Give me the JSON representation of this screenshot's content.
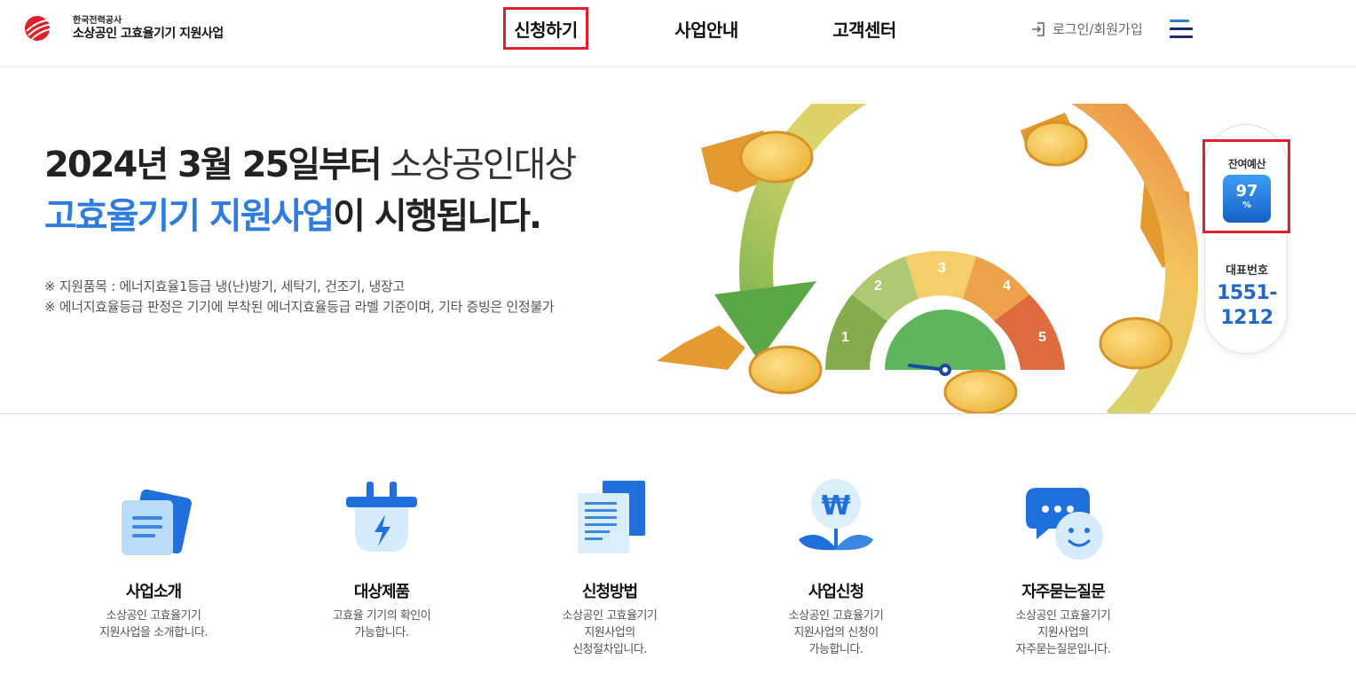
{
  "header": {
    "logo_sub": "한국전력공사",
    "logo_main": "소상공인 고효율기기 지원사업",
    "nav": [
      {
        "label": "신청하기"
      },
      {
        "label": "사업안내"
      },
      {
        "label": "고객센터"
      }
    ],
    "login_label": "로그인/회원가입"
  },
  "hero": {
    "line1_bold": "2024년 3월 25일부터",
    "line1_thin": " 소상공인대상",
    "line2_blue": "고효율기기 지원사업",
    "line2_rest": "이 시행됩니다.",
    "note1": "※ 지원품목 : 에너지효율1등급 냉(난)방기, 세탁기, 건조기, 냉장고",
    "note2": "※ 에너지효율등급 판정은 기기에 부착된 에너지효율등급 라벨 기준이며, 기타 증빙은 인정불가",
    "gauge_labels": [
      "1",
      "2",
      "3",
      "4",
      "5"
    ]
  },
  "side": {
    "budget_label": "잔여예산",
    "budget_value": "97",
    "budget_unit": "%",
    "phone_label": "대표번호",
    "phone_line1": "1551-",
    "phone_line2": "1212"
  },
  "services": [
    {
      "title": "사업소개",
      "desc": "소상공인 고효율기기\n지원사업을 소개합니다."
    },
    {
      "title": "대상제품",
      "desc": "고효율 기기의 확인이\n가능합니다."
    },
    {
      "title": "신청방법",
      "desc": "소상공인 고효율기기\n지원사업의\n신청절차입니다."
    },
    {
      "title": "사업신청",
      "desc": "소상공인 고효율기기\n지원사업의 신청이\n가능합니다."
    },
    {
      "title": "자주묻는질문",
      "desc": "소상공인 고효율기기\n지원사업의\n자주묻는질문입니다."
    }
  ],
  "colors": {
    "brand_red": "#e0202a",
    "accent_blue": "#2f7ce0",
    "phone_blue": "#2467c7"
  }
}
